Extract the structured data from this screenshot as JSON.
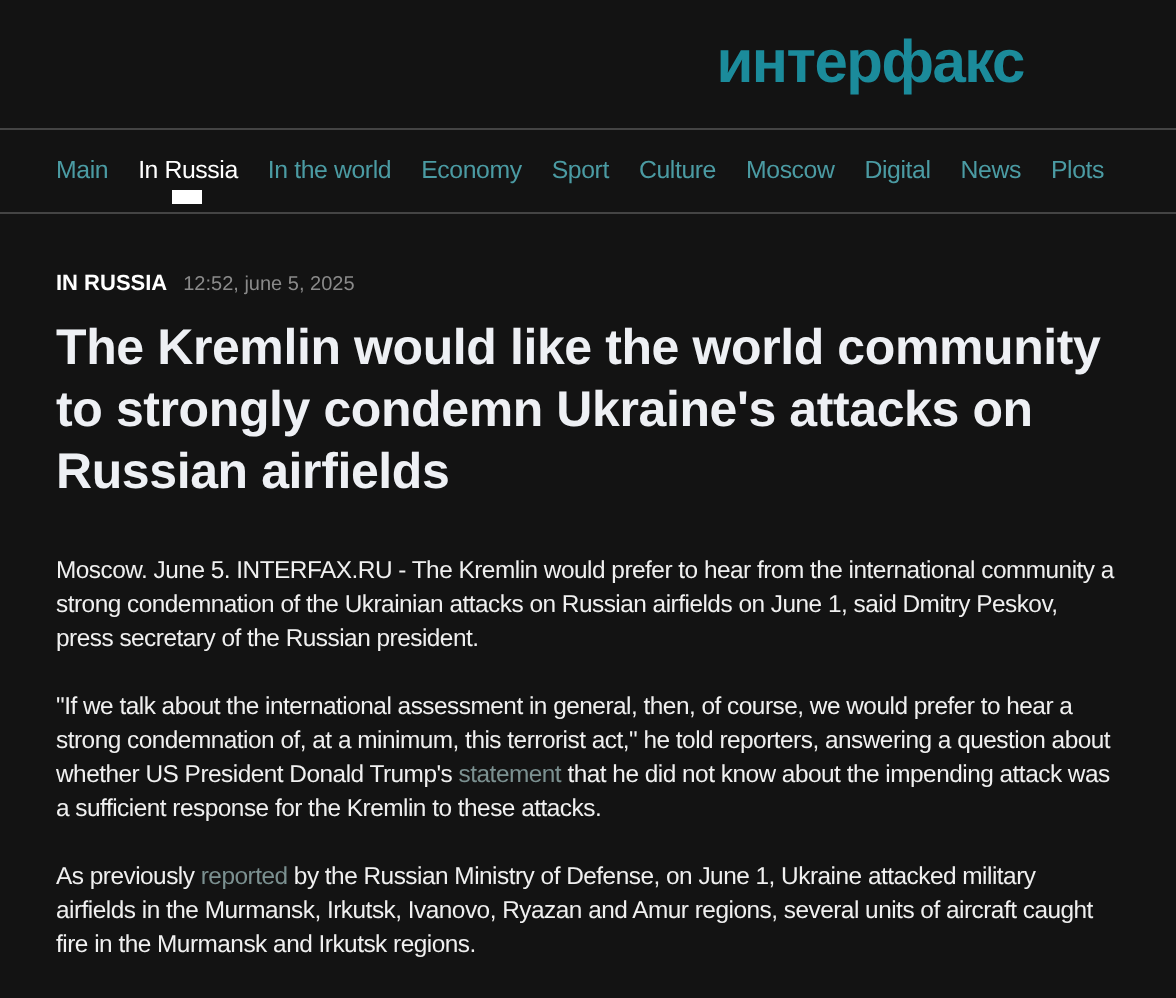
{
  "logo": {
    "text": "интерфакс"
  },
  "nav": [
    {
      "label": "Main",
      "selected": false
    },
    {
      "label": "In Russia",
      "selected": true
    },
    {
      "label": "In the world",
      "selected": false
    },
    {
      "label": "Economy",
      "selected": false
    },
    {
      "label": "Sport",
      "selected": false
    },
    {
      "label": "Culture",
      "selected": false
    },
    {
      "label": "Moscow",
      "selected": false
    },
    {
      "label": "Digital",
      "selected": false
    },
    {
      "label": "News",
      "selected": false
    },
    {
      "label": "Plots",
      "selected": false
    }
  ],
  "article": {
    "section": "IN RUSSIA",
    "time": "12:52, june 5, 2025",
    "headline": "The Kremlin would like the world community to strongly condemn Ukraine's attacks on Russian airfields",
    "paragraphs": [
      [
        {
          "kind": "text",
          "text": "Moscow. June 5. INTERFAX.RU - The Kremlin would prefer to hear from the international community a strong condemnation of the Ukrainian attacks on Russian airfields on June 1, said Dmitry Peskov, press secretary of the Russian president."
        }
      ],
      [
        {
          "kind": "text",
          "text": "\"If we talk about the international assessment in general, then, of course, we would prefer to hear a strong condemnation of, at a minimum, this terrorist act,\" he told reporters, answering a question about whether US President Donald Trump's "
        },
        {
          "kind": "link",
          "text": "statement"
        },
        {
          "kind": "text",
          "text": " that he did not know about the impending attack was a sufficient response for the Kremlin to these attacks."
        }
      ],
      [
        {
          "kind": "text",
          "text": "As previously "
        },
        {
          "kind": "link",
          "text": "reported"
        },
        {
          "kind": "text",
          "text": " by the Russian Ministry of Defense, on June 1, Ukraine attacked military airfields in the Murmansk, Irkutsk, Ivanovo, Ryazan and Amur regions, several units of aircraft caught fire in the Murmansk and Irkutsk regions."
        }
      ]
    ]
  }
}
